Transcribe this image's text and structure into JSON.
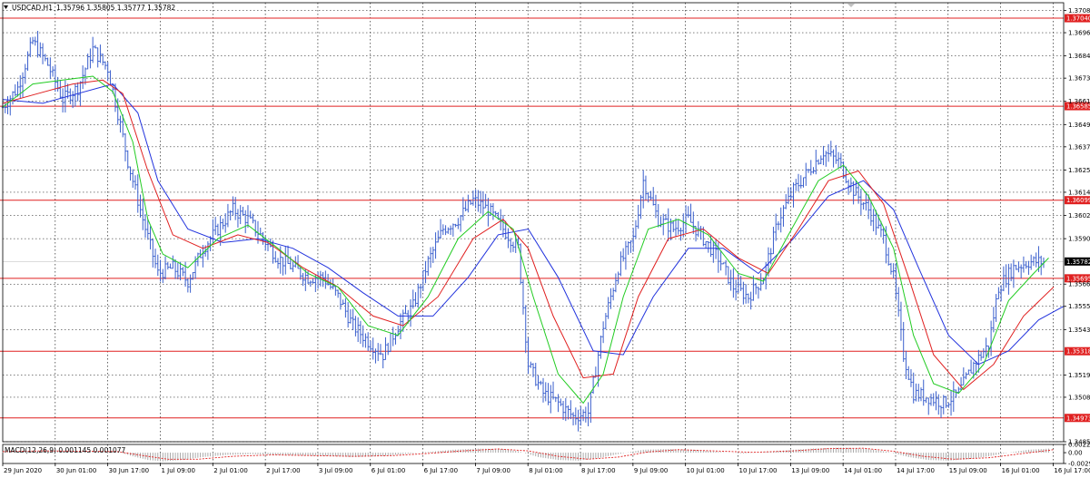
{
  "colors": {
    "background": "#ffffff",
    "grid": "#000000",
    "candles": "#3a5fcd",
    "level_line": "#e02020",
    "ma_green": "#22cc22",
    "ma_red": "#e02020",
    "ma_blue": "#2233dd",
    "macd_hist": "#a0a0a0",
    "macd_signal": "#e02020",
    "current_price_label": "#000000"
  },
  "header": {
    "symbol_label": "USDCAD,H1",
    "ohlc": "1.35796 1.35805 1.35777 1.35782",
    "menu_icon": "triangle-down-icon"
  },
  "macd": {
    "label": "MACD(12,26,9) 0.001145 0.001077",
    "y_ticks": [
      "0.002255",
      "0.00",
      "-0.00297"
    ]
  },
  "chart_data": [
    {
      "type": "candlestick",
      "title": "USDCAD,H1",
      "ylim": [
        1.3485,
        1.3712
      ],
      "y_ticks": [
        "1.37080",
        "1.36965",
        "1.36845",
        "1.36730",
        "1.36610",
        "1.36490",
        "1.36375",
        "1.36255",
        "1.36140",
        "1.36020",
        "1.35900",
        "1.35665",
        "1.35550",
        "1.35430",
        "1.35195",
        "1.35080",
        "1.34850"
      ],
      "x_ticks": [
        "29 Jun 2020",
        "30 Jun 01:00",
        "30 Jun 17:00",
        "1 Jul 09:00",
        "2 Jul 01:00",
        "2 Jul 17:00",
        "3 Jul 09:00",
        "6 Jul 01:00",
        "6 Jul 17:00",
        "7 Jul 09:00",
        "8 Jul 01:00",
        "8 Jul 17:00",
        "9 Jul 09:00",
        "10 Jul 01:00",
        "10 Jul 17:00",
        "13 Jul 09:00",
        "14 Jul 01:00",
        "14 Jul 17:00",
        "15 Jul 09:00",
        "16 Jul 01:00",
        "16 Jul 17:00"
      ],
      "levels": [
        "1.37040",
        "1.36585",
        "1.36099",
        "1.35695",
        "1.35318",
        "1.34973"
      ],
      "current_price": "1.35782",
      "close_path": [
        [
          0,
          1.3658
        ],
        [
          6,
          1.3668
        ],
        [
          12,
          1.3692
        ],
        [
          18,
          1.368
        ],
        [
          24,
          1.3662
        ],
        [
          30,
          1.3668
        ],
        [
          36,
          1.3688
        ],
        [
          42,
          1.3678
        ],
        [
          46,
          1.3655
        ],
        [
          50,
          1.363
        ],
        [
          56,
          1.36
        ],
        [
          62,
          1.3572
        ],
        [
          68,
          1.3575
        ],
        [
          74,
          1.3568
        ],
        [
          80,
          1.3585
        ],
        [
          86,
          1.3595
        ],
        [
          92,
          1.3605
        ],
        [
          98,
          1.36
        ],
        [
          104,
          1.359
        ],
        [
          110,
          1.358
        ],
        [
          116,
          1.3575
        ],
        [
          122,
          1.357
        ],
        [
          128,
          1.357
        ],
        [
          134,
          1.356
        ],
        [
          140,
          1.3545
        ],
        [
          146,
          1.3537
        ],
        [
          152,
          1.353
        ],
        [
          158,
          1.3545
        ],
        [
          164,
          1.3555
        ],
        [
          170,
          1.3578
        ],
        [
          176,
          1.3595
        ],
        [
          182,
          1.36
        ],
        [
          188,
          1.361
        ],
        [
          194,
          1.3605
        ],
        [
          200,
          1.3595
        ],
        [
          206,
          1.3585
        ],
        [
          210,
          1.3525
        ],
        [
          216,
          1.351
        ],
        [
          222,
          1.3505
        ],
        [
          228,
          1.3498
        ],
        [
          234,
          1.35
        ],
        [
          240,
          1.3545
        ],
        [
          246,
          1.3575
        ],
        [
          252,
          1.359
        ],
        [
          256,
          1.362
        ],
        [
          262,
          1.36
        ],
        [
          268,
          1.3595
        ],
        [
          274,
          1.36
        ],
        [
          280,
          1.359
        ],
        [
          286,
          1.358
        ],
        [
          292,
          1.3565
        ],
        [
          298,
          1.356
        ],
        [
          304,
          1.357
        ],
        [
          310,
          1.36
        ],
        [
          316,
          1.3615
        ],
        [
          322,
          1.3625
        ],
        [
          328,
          1.3635
        ],
        [
          334,
          1.363
        ],
        [
          340,
          1.3615
        ],
        [
          346,
          1.3605
        ],
        [
          352,
          1.359
        ],
        [
          356,
          1.357
        ],
        [
          360,
          1.353
        ],
        [
          364,
          1.351
        ],
        [
          370,
          1.3508
        ],
        [
          376,
          1.3505
        ],
        [
          382,
          1.351
        ],
        [
          388,
          1.3525
        ],
        [
          394,
          1.3535
        ],
        [
          398,
          1.3565
        ],
        [
          404,
          1.3575
        ],
        [
          410,
          1.3578
        ],
        [
          416,
          1.3578
        ]
      ],
      "ma_green_path": [
        [
          0,
          1.3658
        ],
        [
          12,
          1.367
        ],
        [
          24,
          1.3672
        ],
        [
          36,
          1.3674
        ],
        [
          44,
          1.3666
        ],
        [
          52,
          1.364
        ],
        [
          58,
          1.36
        ],
        [
          64,
          1.3582
        ],
        [
          74,
          1.3575
        ],
        [
          86,
          1.359
        ],
        [
          98,
          1.3597
        ],
        [
          110,
          1.3585
        ],
        [
          122,
          1.3572
        ],
        [
          134,
          1.3565
        ],
        [
          146,
          1.3545
        ],
        [
          158,
          1.354
        ],
        [
          170,
          1.356
        ],
        [
          182,
          1.359
        ],
        [
          194,
          1.3604
        ],
        [
          204,
          1.3595
        ],
        [
          212,
          1.356
        ],
        [
          222,
          1.352
        ],
        [
          232,
          1.3505
        ],
        [
          240,
          1.352
        ],
        [
          248,
          1.356
        ],
        [
          258,
          1.3595
        ],
        [
          270,
          1.36
        ],
        [
          282,
          1.3592
        ],
        [
          294,
          1.3572
        ],
        [
          304,
          1.3568
        ],
        [
          314,
          1.3592
        ],
        [
          326,
          1.362
        ],
        [
          336,
          1.3628
        ],
        [
          346,
          1.3612
        ],
        [
          356,
          1.3585
        ],
        [
          364,
          1.354
        ],
        [
          372,
          1.3515
        ],
        [
          382,
          1.351
        ],
        [
          392,
          1.3525
        ],
        [
          402,
          1.3558
        ],
        [
          412,
          1.3572
        ],
        [
          418,
          1.358
        ]
      ],
      "ma_red_path": [
        [
          0,
          1.366
        ],
        [
          14,
          1.3665
        ],
        [
          28,
          1.367
        ],
        [
          40,
          1.3672
        ],
        [
          48,
          1.3665
        ],
        [
          58,
          1.3625
        ],
        [
          68,
          1.3592
        ],
        [
          80,
          1.3585
        ],
        [
          94,
          1.3592
        ],
        [
          106,
          1.3588
        ],
        [
          120,
          1.3575
        ],
        [
          134,
          1.3565
        ],
        [
          148,
          1.355
        ],
        [
          160,
          1.3545
        ],
        [
          174,
          1.356
        ],
        [
          188,
          1.359
        ],
        [
          200,
          1.36
        ],
        [
          210,
          1.3585
        ],
        [
          220,
          1.355
        ],
        [
          232,
          1.3518
        ],
        [
          244,
          1.352
        ],
        [
          254,
          1.356
        ],
        [
          266,
          1.359
        ],
        [
          280,
          1.3595
        ],
        [
          294,
          1.358
        ],
        [
          306,
          1.3572
        ],
        [
          318,
          1.3595
        ],
        [
          330,
          1.362
        ],
        [
          342,
          1.3625
        ],
        [
          352,
          1.3608
        ],
        [
          362,
          1.357
        ],
        [
          372,
          1.353
        ],
        [
          384,
          1.3512
        ],
        [
          396,
          1.3525
        ],
        [
          408,
          1.355
        ],
        [
          420,
          1.3565
        ]
      ],
      "ma_blue_path": [
        [
          0,
          1.3662
        ],
        [
          16,
          1.366
        ],
        [
          30,
          1.3665
        ],
        [
          44,
          1.367
        ],
        [
          54,
          1.3655
        ],
        [
          62,
          1.362
        ],
        [
          74,
          1.3595
        ],
        [
          88,
          1.3588
        ],
        [
          102,
          1.359
        ],
        [
          116,
          1.3585
        ],
        [
          130,
          1.3575
        ],
        [
          144,
          1.3562
        ],
        [
          158,
          1.355
        ],
        [
          172,
          1.355
        ],
        [
          186,
          1.357
        ],
        [
          198,
          1.3592
        ],
        [
          210,
          1.3595
        ],
        [
          222,
          1.357
        ],
        [
          236,
          1.3532
        ],
        [
          248,
          1.353
        ],
        [
          260,
          1.356
        ],
        [
          274,
          1.3585
        ],
        [
          288,
          1.3585
        ],
        [
          302,
          1.3572
        ],
        [
          316,
          1.359
        ],
        [
          330,
          1.3612
        ],
        [
          344,
          1.362
        ],
        [
          356,
          1.3605
        ],
        [
          366,
          1.3575
        ],
        [
          378,
          1.354
        ],
        [
          390,
          1.3525
        ],
        [
          402,
          1.3532
        ],
        [
          414,
          1.3548
        ],
        [
          424,
          1.3555
        ]
      ],
      "macd_hist_path": [
        [
          0,
          0.0002
        ],
        [
          8,
          0.0004
        ],
        [
          16,
          0.0006
        ],
        [
          24,
          0.0004
        ],
        [
          32,
          0.0003
        ],
        [
          40,
          0.0005
        ],
        [
          46,
          0.0003
        ],
        [
          52,
          -0.001
        ],
        [
          58,
          -0.002
        ],
        [
          64,
          -0.0024
        ],
        [
          72,
          -0.002
        ],
        [
          80,
          -0.0012
        ],
        [
          90,
          -0.0006
        ],
        [
          100,
          -0.0004
        ],
        [
          110,
          -0.0006
        ],
        [
          120,
          -0.0008
        ],
        [
          130,
          -0.0009
        ],
        [
          140,
          -0.0012
        ],
        [
          150,
          -0.001
        ],
        [
          160,
          -0.0004
        ],
        [
          170,
          0.0002
        ],
        [
          180,
          0.0008
        ],
        [
          190,
          0.0011
        ],
        [
          200,
          0.001
        ],
        [
          206,
          0.0004
        ],
        [
          214,
          -0.0012
        ],
        [
          222,
          -0.002
        ],
        [
          230,
          -0.0022
        ],
        [
          238,
          -0.0015
        ],
        [
          246,
          -0.0004
        ],
        [
          256,
          0.0008
        ],
        [
          266,
          0.001
        ],
        [
          276,
          0.0008
        ],
        [
          286,
          0.0002
        ],
        [
          296,
          -0.0002
        ],
        [
          306,
          0.0002
        ],
        [
          316,
          0.0008
        ],
        [
          326,
          0.0012
        ],
        [
          336,
          0.0014
        ],
        [
          346,
          0.001
        ],
        [
          354,
          0.0002
        ],
        [
          362,
          -0.0012
        ],
        [
          370,
          -0.002
        ],
        [
          378,
          -0.0022
        ],
        [
          386,
          -0.0018
        ],
        [
          394,
          -0.001
        ],
        [
          402,
          0.0
        ],
        [
          410,
          0.0008
        ],
        [
          418,
          0.0011
        ]
      ],
      "macd_signal_path": [
        [
          0,
          0.0003
        ],
        [
          16,
          0.0005
        ],
        [
          32,
          0.0004
        ],
        [
          46,
          0.0003
        ],
        [
          56,
          -0.0008
        ],
        [
          66,
          -0.0018
        ],
        [
          78,
          -0.0018
        ],
        [
          92,
          -0.001
        ],
        [
          108,
          -0.0006
        ],
        [
          124,
          -0.0008
        ],
        [
          140,
          -0.001
        ],
        [
          156,
          -0.0008
        ],
        [
          170,
          -0.0002
        ],
        [
          184,
          0.0005
        ],
        [
          198,
          0.001
        ],
        [
          210,
          0.0005
        ],
        [
          222,
          -0.001
        ],
        [
          234,
          -0.0018
        ],
        [
          246,
          -0.0012
        ],
        [
          258,
          0.0002
        ],
        [
          270,
          0.0008
        ],
        [
          284,
          0.0005
        ],
        [
          300,
          0.0001
        ],
        [
          316,
          0.0005
        ],
        [
          330,
          0.0011
        ],
        [
          344,
          0.0012
        ],
        [
          356,
          0.0004
        ],
        [
          368,
          -0.001
        ],
        [
          380,
          -0.0018
        ],
        [
          394,
          -0.0014
        ],
        [
          408,
          -0.0002
        ],
        [
          420,
          0.0008
        ]
      ]
    }
  ]
}
